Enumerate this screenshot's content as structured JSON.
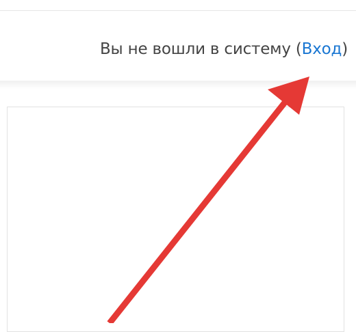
{
  "header": {
    "login_prefix": "Вы не вошли в систему (",
    "login_link_label": "Вход",
    "login_suffix": ")"
  },
  "colors": {
    "link": "#1976d2",
    "text": "#444444",
    "annotation_arrow": "#e53935"
  }
}
